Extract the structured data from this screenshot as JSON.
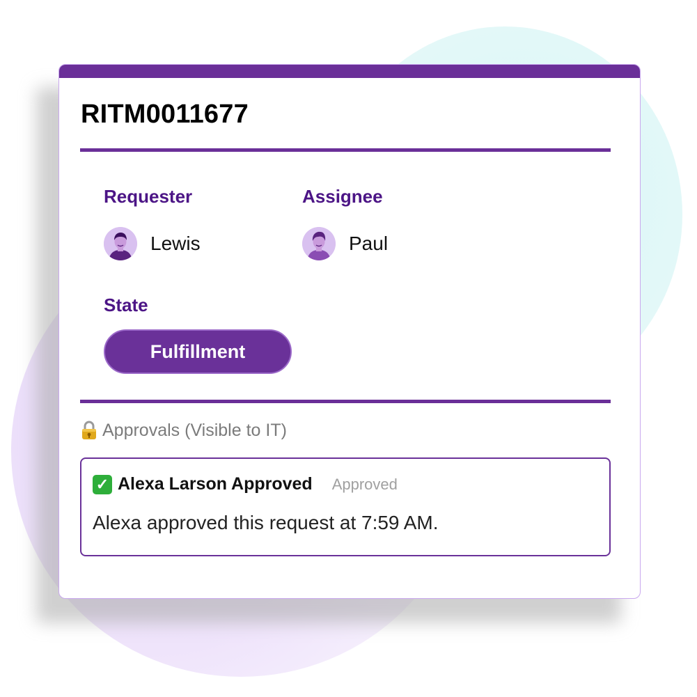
{
  "ticket": {
    "id": "RITM0011677"
  },
  "requester": {
    "label": "Requester",
    "name": "Lewis",
    "avatar_icon": "person-avatar-icon"
  },
  "assignee": {
    "label": "Assignee",
    "name": "Paul",
    "avatar_icon": "person-avatar-icon"
  },
  "state": {
    "label": "State",
    "value": "Fulfillment"
  },
  "approvals": {
    "icon": "lock-key-icon",
    "heading": "Approvals (Visible to IT)",
    "items": [
      {
        "icon": "check-mark-icon",
        "title": "Alexa Larson Approved",
        "status": "Approved",
        "description": "Alexa approved this request at 7:59 AM."
      }
    ]
  },
  "colors": {
    "primary": "#6a2f98",
    "label": "#4c1586",
    "muted": "#7b7b7b",
    "success": "#2eae3a"
  }
}
